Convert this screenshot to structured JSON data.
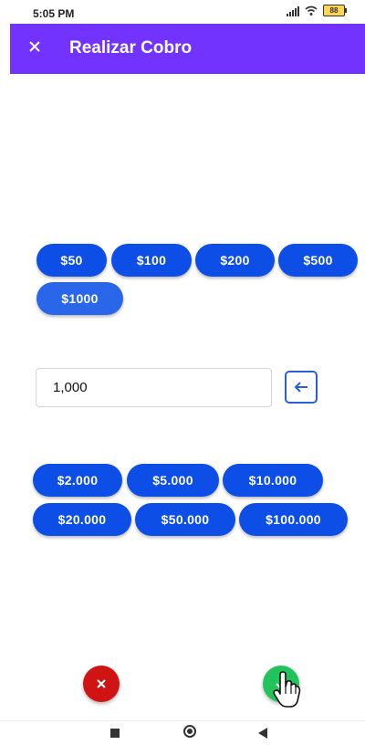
{
  "status_bar": {
    "time": "5:05 PM",
    "battery": "88"
  },
  "app_bar": {
    "close_icon": "close-icon",
    "title": "Realizar Cobro",
    "color": "#7233ff"
  },
  "quick_amounts": [
    "$50",
    "$100",
    "$200",
    "$500",
    "$1000"
  ],
  "amount_field": {
    "value": "1,000",
    "backspace_icon": "arrow-left-icon"
  },
  "large_amounts": [
    "$2.000",
    "$5.000",
    "$10.000",
    "$20.000",
    "$50.000",
    "$100.000"
  ],
  "actions": {
    "cancel_icon": "close-icon",
    "cancel_color": "#d01414",
    "confirm_icon": "check-icon",
    "confirm_color": "#21c35a"
  },
  "nav_bar": {
    "recents_icon": "square-icon",
    "home_icon": "circle-icon",
    "back_icon": "triangle-back-icon"
  },
  "colors": {
    "chip": "#0c4ee6",
    "chip_selected": "#2a66ea"
  }
}
